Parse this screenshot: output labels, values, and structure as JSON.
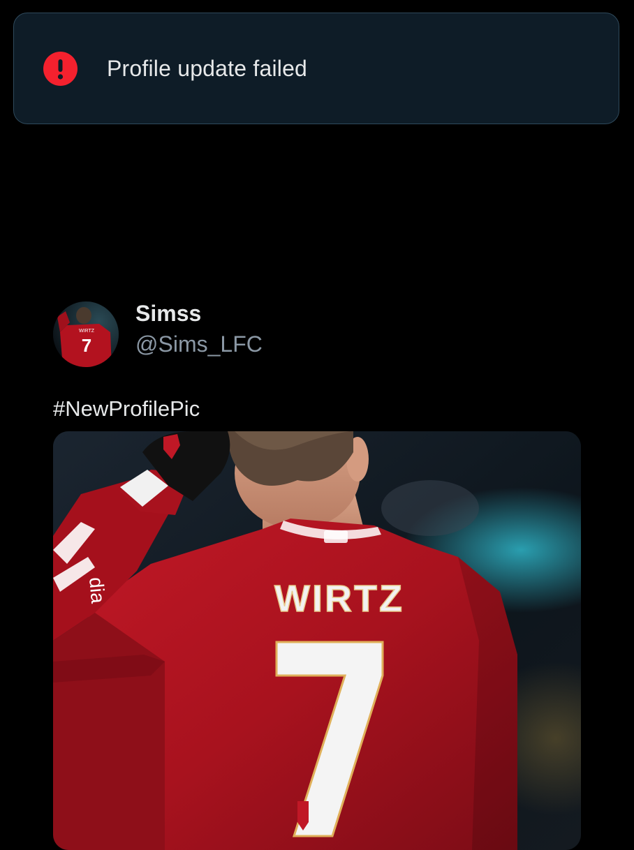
{
  "toast": {
    "icon": "error-exclamation-icon",
    "icon_color": "#f4212e",
    "message": "Profile update failed"
  },
  "post": {
    "author": {
      "display_name": "Simss",
      "handle": "@Sims_LFC",
      "avatar": "player-wirtz-7-avatar"
    },
    "text": "#NewProfilePic",
    "media": {
      "description_icon": "player-back-photo",
      "jersey_name": "WIRTZ",
      "jersey_number": "7",
      "sleeve_text": "dia",
      "shirt_color": "#b3121f"
    }
  }
}
